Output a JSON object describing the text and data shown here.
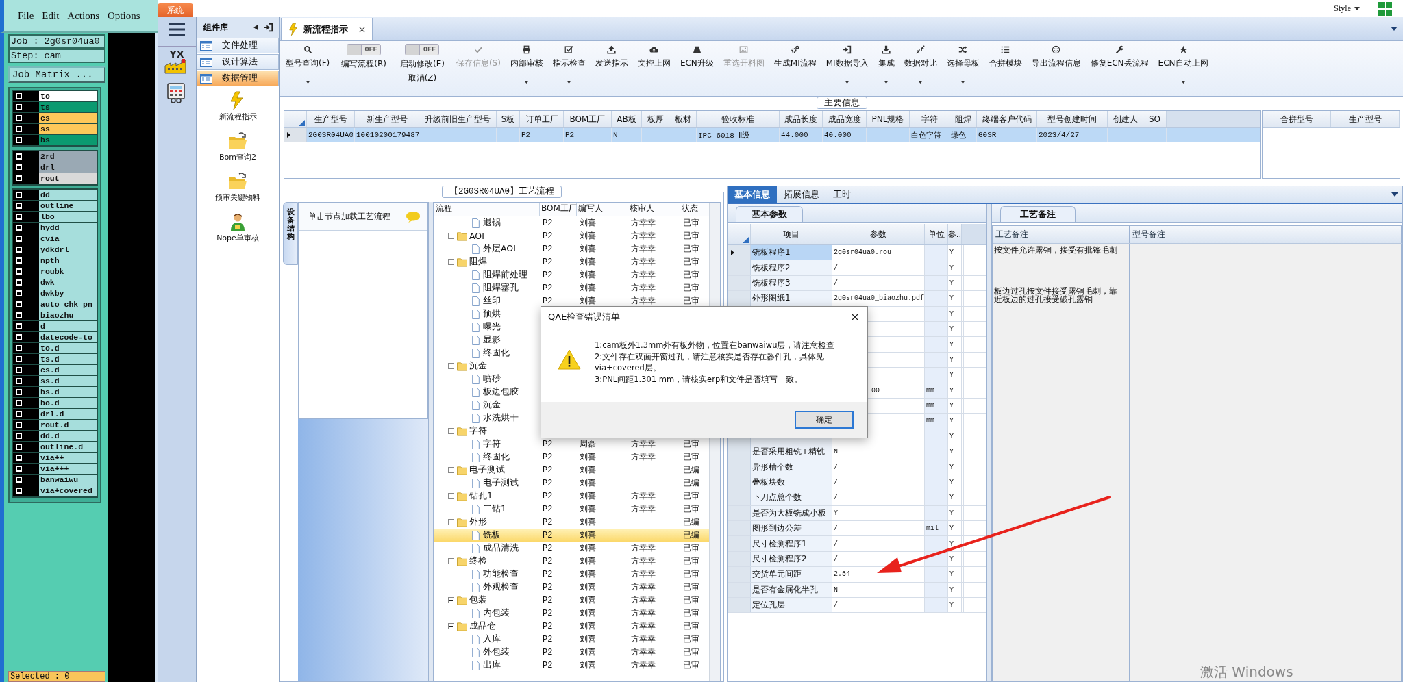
{
  "cam": {
    "menu": [
      "File",
      "Edit",
      "Actions",
      "Options"
    ],
    "job": "Job : 2g0sr04ua0",
    "step": "Step: cam",
    "matrix_button": "Job Matrix ...",
    "layer_groups": [
      [
        {
          "name": "to",
          "color": "#ffffff",
          "checked": false
        },
        {
          "name": "ts",
          "color": "#0b9a70",
          "checked": false
        },
        {
          "name": "cs",
          "color": "#fdc85a",
          "checked": false
        },
        {
          "name": "ss",
          "color": "#fdc85a",
          "checked": false
        },
        {
          "name": "bs",
          "color": "#0b9a70",
          "checked": false
        }
      ],
      [
        {
          "name": "2rd",
          "color": "#9aa9b4",
          "checked": false
        },
        {
          "name": "drl",
          "color": "#9aa9b4",
          "checked": false
        },
        {
          "name": "rout",
          "color": "#d9d9d9",
          "checked": false
        }
      ],
      [
        {
          "name": "dd",
          "color": "#a6dedc",
          "checked": false
        },
        {
          "name": "outline",
          "color": "#a6dedc",
          "checked": false
        },
        {
          "name": "lbo",
          "color": "#a6dedc",
          "checked": false
        },
        {
          "name": "hydd",
          "color": "#a6dedc",
          "checked": false
        },
        {
          "name": "cvia",
          "color": "#a6dedc",
          "checked": false
        },
        {
          "name": "ydkdrl",
          "color": "#a6dedc",
          "checked": false
        },
        {
          "name": "npth",
          "color": "#a6dedc",
          "checked": false
        },
        {
          "name": "roubk",
          "color": "#a6dedc",
          "checked": false
        },
        {
          "name": "dwk",
          "color": "#a6dedc",
          "checked": false
        },
        {
          "name": "dwkby",
          "color": "#a6dedc",
          "checked": false
        },
        {
          "name": "auto_chk_pn",
          "color": "#a6dedc",
          "checked": false
        },
        {
          "name": "biaozhu",
          "color": "#a6dedc",
          "checked": false
        },
        {
          "name": "d",
          "color": "#a6dedc",
          "checked": false
        },
        {
          "name": "datecode-to",
          "color": "#a6dedc",
          "checked": false
        },
        {
          "name": "to.d",
          "color": "#a6dedc",
          "checked": false
        },
        {
          "name": "ts.d",
          "color": "#a6dedc",
          "checked": false
        },
        {
          "name": "cs.d",
          "color": "#a6dedc",
          "checked": false
        },
        {
          "name": "ss.d",
          "color": "#a6dedc",
          "checked": false
        },
        {
          "name": "bs.d",
          "color": "#a6dedc",
          "checked": false
        },
        {
          "name": "bo.d",
          "color": "#a6dedc",
          "checked": false
        },
        {
          "name": "drl.d",
          "color": "#a6dedc",
          "checked": false
        },
        {
          "name": "rout.d",
          "color": "#a6dedc",
          "checked": false
        },
        {
          "name": "dd.d",
          "color": "#a6dedc",
          "checked": false
        },
        {
          "name": "outline.d",
          "color": "#a6dedc",
          "checked": false
        },
        {
          "name": "via++",
          "color": "#a6dedc",
          "checked": false
        },
        {
          "name": "via+++",
          "color": "#a6dedc",
          "checked": false
        },
        {
          "name": "banwaiwu",
          "color": "#a6dedc",
          "checked": false
        },
        {
          "name": "via+covered",
          "color": "#a6dedc",
          "checked": false
        }
      ]
    ],
    "status": "Selected : 0"
  },
  "app": {
    "system_tab": "系统",
    "style_menu": "Style",
    "logo_text": "YX",
    "watermark": "激活 Windows"
  },
  "component_panel": {
    "title": "组件库",
    "categories": [
      {
        "label": "文件处理",
        "selected": false
      },
      {
        "label": "设计算法",
        "selected": false
      },
      {
        "label": "数据管理",
        "selected": true
      }
    ],
    "modules": [
      {
        "label": "新流程指示",
        "selected": false
      },
      {
        "label": "Bom查询2",
        "selected": false
      },
      {
        "label": "预审关键物料",
        "selected": false
      },
      {
        "label": "Nope单审核",
        "selected": false
      }
    ]
  },
  "document_tab": {
    "label": "新流程指示",
    "selected": true
  },
  "toolbar": [
    {
      "kind": "button",
      "label": "型号查询(F)",
      "dropdown": true,
      "disabled": false
    },
    {
      "kind": "toggle",
      "label": "编写流程(R)",
      "state_text": "OFF",
      "on": false
    },
    {
      "kind": "toggle",
      "label": "启动修改(E)",
      "label2": "取消(Z)",
      "state_text": "OFF",
      "on": false
    },
    {
      "kind": "button",
      "label": "保存信息(S)",
      "dropdown": false,
      "disabled": true
    },
    {
      "kind": "button",
      "label": "内部审核",
      "dropdown": true,
      "disabled": false
    },
    {
      "kind": "button",
      "label": "指示检查",
      "dropdown": true,
      "disabled": false
    },
    {
      "kind": "button",
      "label": "发送指示",
      "dropdown": false,
      "disabled": false
    },
    {
      "kind": "button",
      "label": "文控上网",
      "dropdown": false,
      "disabled": false
    },
    {
      "kind": "button",
      "label": "ECN升级",
      "dropdown": false,
      "disabled": false
    },
    {
      "kind": "button",
      "label": "重选开料图",
      "dropdown": false,
      "disabled": true
    },
    {
      "kind": "button",
      "label": "生成MI流程",
      "dropdown": false,
      "disabled": false
    },
    {
      "kind": "button",
      "label": "MI数据导入",
      "dropdown": true,
      "disabled": false
    },
    {
      "kind": "button",
      "label": "集成",
      "dropdown": true,
      "disabled": false
    },
    {
      "kind": "button",
      "label": "数据对比",
      "dropdown": true,
      "disabled": false
    },
    {
      "kind": "button",
      "label": "选择母板",
      "dropdown": true,
      "disabled": false
    },
    {
      "kind": "button",
      "label": "合拼模块",
      "dropdown": false,
      "disabled": false
    },
    {
      "kind": "button",
      "label": "导出流程信息",
      "dropdown": false,
      "disabled": false
    },
    {
      "kind": "button",
      "label": "修复ECN丢流程",
      "dropdown": false,
      "disabled": false
    },
    {
      "kind": "button",
      "label": "ECN自动上网",
      "dropdown": true,
      "disabled": false
    }
  ],
  "main_info": {
    "title": "主要信息",
    "columns": [
      "生产型号",
      "新生产型号",
      "升级前旧生产型号",
      "S板",
      "订单工厂",
      "BOM工厂",
      "AB板",
      "板厚",
      "板材",
      "验收标准",
      "成品长度",
      "成品宽度",
      "PNL规格",
      "字符",
      "阻焊",
      "终端客户代码",
      "型号创建时间",
      "创建人",
      "SO"
    ],
    "rows": [
      {
        "selected": true,
        "cells": [
          "2G0SR04UA0",
          "10010200179487",
          null,
          null,
          "P2",
          "P2",
          "N",
          null,
          null,
          "IPC-6018 Ⅱ级",
          "44.000",
          "40.000",
          null,
          "白色字符",
          "绿色",
          "G0SR",
          "2023/4/27",
          null,
          null
        ]
      }
    ],
    "merge_columns": [
      "合拼型号",
      "生产型号"
    ]
  },
  "process": {
    "title": "【2G0SR04UA0】工艺流程",
    "side_tab": "设备结构",
    "hint": "单击节点加载工艺流程",
    "columns": [
      "流程",
      "BOM工厂",
      "编写人",
      "核审人",
      "状态"
    ],
    "tree": [
      {
        "children": [
          {
            "label": "退锡",
            "bom": "P2",
            "writer": "刘喜",
            "reviewer": "方幸幸",
            "status": "已审",
            "selected": false
          }
        ]
      },
      {
        "label": "AOI",
        "expanded": true,
        "bom": "P2",
        "writer": "刘喜",
        "reviewer": "方幸幸",
        "status": "已审",
        "selected": false,
        "children": [
          {
            "label": "外层AOI",
            "bom": "P2",
            "writer": "刘喜",
            "reviewer": "方幸幸",
            "status": "已审",
            "selected": false
          }
        ]
      },
      {
        "label": "阻焊",
        "expanded": true,
        "bom": "P2",
        "writer": "刘喜",
        "reviewer": "方幸幸",
        "status": "已审",
        "selected": false,
        "children": [
          {
            "label": "阻焊前处理",
            "bom": "P2",
            "writer": "刘喜",
            "reviewer": "方幸幸",
            "status": "已审",
            "selected": false
          },
          {
            "label": "阻焊塞孔",
            "bom": "P2",
            "writer": "刘喜",
            "reviewer": "方幸幸",
            "status": "已审",
            "selected": false
          },
          {
            "label": "丝印",
            "bom": "P2",
            "writer": "刘喜",
            "reviewer": "方幸幸",
            "status": "已审",
            "selected": false
          },
          {
            "label": "预烘",
            "selected": false
          },
          {
            "label": "曝光",
            "selected": false
          },
          {
            "label": "显影",
            "selected": false
          },
          {
            "label": "终固化",
            "selected": false
          }
        ]
      },
      {
        "label": "沉金",
        "expanded": true,
        "selected": false,
        "children": [
          {
            "label": "喷砂",
            "selected": false
          },
          {
            "label": "板边包胶",
            "selected": false
          },
          {
            "label": "沉金",
            "selected": false
          },
          {
            "label": "水洗烘干",
            "selected": false
          }
        ]
      },
      {
        "label": "字符",
        "expanded": true,
        "selected": false,
        "children": [
          {
            "label": "字符",
            "bom": "P2",
            "writer": "周磊",
            "reviewer": "方幸幸",
            "status": "已审",
            "selected": false
          },
          {
            "label": "终固化",
            "bom": "P2",
            "writer": "刘喜",
            "reviewer": "方幸幸",
            "status": "已审",
            "selected": false
          }
        ]
      },
      {
        "label": "电子测试",
        "expanded": true,
        "bom": "P2",
        "writer": "刘喜",
        "status": "已编",
        "selected": false,
        "children": [
          {
            "label": "电子测试",
            "bom": "P2",
            "writer": "刘喜",
            "status": "已编",
            "selected": false
          }
        ]
      },
      {
        "label": "钻孔1",
        "expanded": true,
        "bom": "P2",
        "writer": "刘喜",
        "reviewer": "方幸幸",
        "status": "已审",
        "selected": false,
        "children": [
          {
            "label": "二钻1",
            "bom": "P2",
            "writer": "刘喜",
            "reviewer": "方幸幸",
            "status": "已审",
            "selected": false
          }
        ]
      },
      {
        "label": "外形",
        "expanded": true,
        "bom": "P2",
        "writer": "刘喜",
        "status": "已编",
        "selected": false,
        "children": [
          {
            "label": "铣板",
            "bom": "P2",
            "writer": "刘喜",
            "status": "已编",
            "selected": true
          },
          {
            "label": "成品清洗",
            "bom": "P2",
            "writer": "刘喜",
            "reviewer": "方幸幸",
            "status": "已审",
            "selected": false
          }
        ]
      },
      {
        "label": "终检",
        "expanded": true,
        "bom": "P2",
        "writer": "刘喜",
        "reviewer": "方幸幸",
        "status": "已审",
        "selected": false,
        "children": [
          {
            "label": "功能检查",
            "bom": "P2",
            "writer": "刘喜",
            "reviewer": "方幸幸",
            "status": "已审",
            "selected": false
          },
          {
            "label": "外观检查",
            "bom": "P2",
            "writer": "刘喜",
            "reviewer": "方幸幸",
            "status": "已审",
            "selected": false
          }
        ]
      },
      {
        "label": "包装",
        "expanded": true,
        "bom": "P2",
        "writer": "刘喜",
        "reviewer": "方幸幸",
        "status": "已审",
        "selected": false,
        "children": [
          {
            "label": "内包装",
            "bom": "P2",
            "writer": "刘喜",
            "reviewer": "方幸幸",
            "status": "已审",
            "selected": false
          }
        ]
      },
      {
        "label": "成品仓",
        "expanded": true,
        "bom": "P2",
        "writer": "刘喜",
        "reviewer": "方幸幸",
        "status": "已审",
        "selected": false,
        "children": [
          {
            "label": "入库",
            "bom": "P2",
            "writer": "刘喜",
            "reviewer": "方幸幸",
            "status": "已审",
            "selected": false
          },
          {
            "label": "外包装",
            "bom": "P2",
            "writer": "刘喜",
            "reviewer": "方幸幸",
            "status": "已审",
            "selected": false
          },
          {
            "label": "出库",
            "bom": "P2",
            "writer": "刘喜",
            "reviewer": "方幸幸",
            "status": "已审",
            "selected": false
          }
        ]
      }
    ]
  },
  "detail": {
    "tabs": [
      {
        "label": "基本信息",
        "selected": true
      },
      {
        "label": "拓展信息",
        "selected": false
      },
      {
        "label": "工时",
        "selected": false
      }
    ],
    "params_tab": "基本参数",
    "params_columns": [
      "项目",
      "参数",
      "单位",
      "参.."
    ],
    "params": [
      {
        "kind": "plain",
        "item": "铣板程序1",
        "param": "2g0sr04ua0.rou",
        "check": "Y",
        "selected": true
      },
      {
        "kind": "plain",
        "item": "铣板程序2",
        "param": "/",
        "check": "Y",
        "selected": false
      },
      {
        "kind": "plain",
        "item": "铣板程序3",
        "param": "/",
        "check": "Y",
        "selected": false
      },
      {
        "kind": "plain",
        "item": "外形图纸1",
        "param": "2g0sr04ua0_biaozhu.pdf",
        "check": "Y",
        "selected": false
      },
      {
        "kind": "covered",
        "check": "Y"
      },
      {
        "kind": "covered",
        "check": "Y"
      },
      {
        "kind": "covered",
        "check": "Y"
      },
      {
        "kind": "covered",
        "check": "Y"
      },
      {
        "kind": "covered",
        "check": "Y"
      },
      {
        "kind": "covered",
        "param": "00",
        "unit": "mm",
        "check": "Y"
      },
      {
        "kind": "covered",
        "unit": "mm",
        "check": "Y"
      },
      {
        "kind": "covered",
        "unit": "mm",
        "check": "Y"
      },
      {
        "kind": "covered",
        "check": "Y"
      },
      {
        "kind": "plain",
        "item": "是否采用粗铣+精铣",
        "param": "N",
        "check": "Y",
        "selected": false
      },
      {
        "kind": "plain",
        "item": "异形槽个数",
        "param": "/",
        "check": "Y",
        "selected": false
      },
      {
        "kind": "plain",
        "item": "叠板块数",
        "param": "/",
        "check": "Y",
        "selected": false
      },
      {
        "kind": "plain",
        "item": "下刀点总个数",
        "param": "/",
        "check": "Y",
        "selected": false
      },
      {
        "kind": "plain",
        "item": "是否为大板铣成小板",
        "param": "Y",
        "check": "Y",
        "selected": false
      },
      {
        "kind": "plain",
        "item": "图形到边公差",
        "param": "/",
        "unit": "mil",
        "check": "Y",
        "selected": false
      },
      {
        "kind": "plain",
        "item": "尺寸检测程序1",
        "param": "/",
        "check": "Y",
        "selected": false
      },
      {
        "kind": "plain",
        "item": "尺寸检测程序2",
        "param": "/",
        "check": "Y",
        "selected": false
      },
      {
        "kind": "plain",
        "item": "交货单元间距",
        "param": "2.54",
        "check": "Y",
        "selected": false
      },
      {
        "kind": "plain",
        "item": "是否有金属化半孔",
        "param": "N",
        "check": "Y",
        "selected": false
      },
      {
        "kind": "plain",
        "item": "定位孔层",
        "param": "/",
        "check": "Y",
        "selected": false
      }
    ],
    "notes_tab": "工艺备注",
    "notes_columns": [
      "工艺备注",
      "型号备注"
    ],
    "notes": [
      "按文件允许露铜，接受有批锋毛刺",
      "板边过孔按文件接受露铜毛刺，靠近板边的过孔接受破孔露铜"
    ]
  },
  "dialog": {
    "title": "QAE检查错误清单",
    "lines": [
      "1:cam板外1.3mm外有板外物，位置在banwaiwu层，请注意检查",
      "2:文件存在双面开窗过孔，请注意核实是否存在器件孔，具体见via+covered层。",
      "3:PNL间距1.301 mm，请核实erp和文件是否填写一致。"
    ],
    "ok": "确定"
  }
}
